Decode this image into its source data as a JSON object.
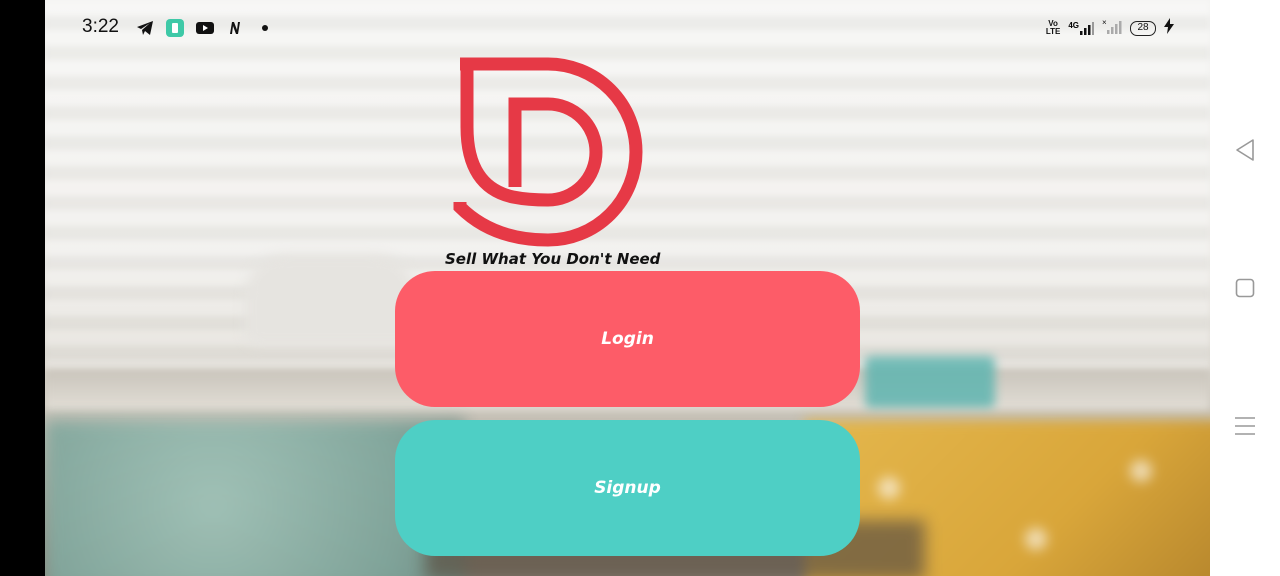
{
  "status_bar": {
    "time": "3:22",
    "left_icons": [
      "telegram-icon",
      "app-icon",
      "youtube-icon",
      "n-app-icon",
      "dot-icon"
    ],
    "right_icons": [
      "volte-icon",
      "signal-4g-icon",
      "signal-empty-icon",
      "battery-icon",
      "charging-icon"
    ],
    "volte_label_top": "Vo",
    "volte_label_bottom": "LTE",
    "network_label": "4G",
    "battery_level": "28"
  },
  "brand": {
    "logo": "d-logo",
    "tagline": "Sell What You Don't Need",
    "accent_color": "#e63946"
  },
  "actions": {
    "login_label": "Login",
    "signup_label": "Signup",
    "login_color": "#fd5c68",
    "signup_color": "#4ecfc5"
  },
  "nav_bar": {
    "buttons": [
      "back-icon",
      "home-icon",
      "menu-icon"
    ]
  }
}
